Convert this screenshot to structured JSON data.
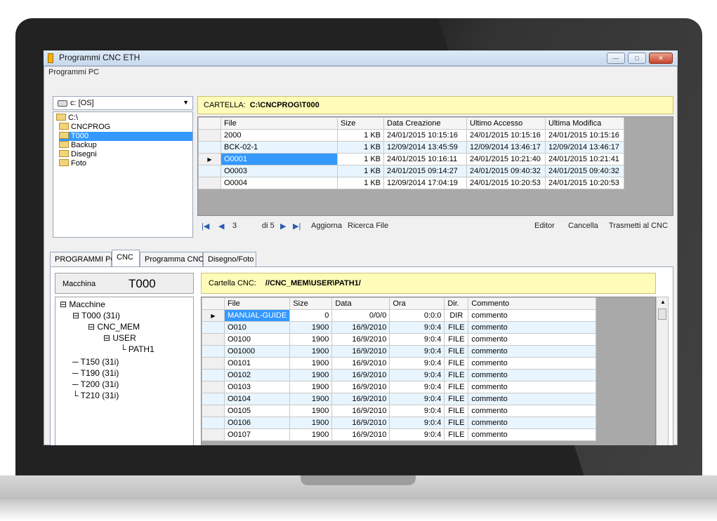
{
  "window": {
    "title": "Programmi CNC ETH",
    "min": "—",
    "max": "□",
    "close": "✕"
  },
  "programmi_pc_label": "Programmi PC",
  "drive_combo": {
    "value": "c: [OS]"
  },
  "folder_tree": [
    "C:\\",
    "CNCPROG",
    "T000",
    "Backup",
    "Disegni",
    "Foto"
  ],
  "cartella": {
    "label": "CARTELLA:",
    "path": "C:\\CNCPROG\\T000"
  },
  "files_table": {
    "headers": [
      "File",
      "Size",
      "Data Creazione",
      "Ultimo Accesso",
      "Ultima Modifica"
    ],
    "rows": [
      [
        "2000",
        "1 KB",
        "24/01/2015 10:15:16",
        "24/01/2015 10:15:16",
        "24/01/2015 10:15:16"
      ],
      [
        "BCK-02-1",
        "1 KB",
        "12/09/2014 13:45:59",
        "12/09/2014 13:46:17",
        "12/09/2014 13:46:17"
      ],
      [
        "O0001",
        "1 KB",
        "24/01/2015 10:16:11",
        "24/01/2015 10:21:40",
        "24/01/2015 10:21:41"
      ],
      [
        "O0003",
        "1 KB",
        "24/01/2015 09:14:27",
        "24/01/2015 09:40:32",
        "24/01/2015 09:40:32"
      ],
      [
        "O0004",
        "1 KB",
        "12/09/2014 17:04:19",
        "24/01/2015 10:20:53",
        "24/01/2015 10:20:53"
      ]
    ]
  },
  "navbar": {
    "position": "3",
    "of": "di 5",
    "aggiorna": "Aggiorna",
    "ricerca": "Ricerca File",
    "editor": "Editor",
    "cancella": "Cancella",
    "trasmetti": "Trasmetti al CNC"
  },
  "tabs": [
    "PROGRAMMI PC",
    "CNC",
    "Programma CNC",
    "Disegno/Foto"
  ],
  "macchina": {
    "label": "Macchina",
    "value": "T000"
  },
  "cartella_cnc": {
    "label": "Cartella CNC:",
    "path": "//CNC_MEM\\USER\\PATH1/"
  },
  "machine_tree": [
    "Macchine",
    "T000 (31i)",
    "CNC_MEM",
    "USER",
    "PATH1",
    "T150 (31i)",
    "T190 (31i)",
    "T200 (31i)",
    "T210 (31i)"
  ],
  "cnc_table": {
    "headers": [
      "File",
      "Size",
      "Data",
      "Ora",
      "Dir.",
      "Commento"
    ],
    "rows": [
      [
        "MANUAL-GUIDE",
        "0",
        "0/0/0",
        "0:0:0",
        "DIR",
        "commento"
      ],
      [
        "O010",
        "1900",
        "16/9/2010",
        "9:0:4",
        "FILE",
        "commento"
      ],
      [
        "O0100",
        "1900",
        "16/9/2010",
        "9:0:4",
        "FILE",
        "commento"
      ],
      [
        "O01000",
        "1900",
        "16/9/2010",
        "9:0:4",
        "FILE",
        "commento"
      ],
      [
        "O0101",
        "1900",
        "16/9/2010",
        "9:0:4",
        "FILE",
        "commento"
      ],
      [
        "O0102",
        "1900",
        "16/9/2010",
        "9:0:4",
        "FILE",
        "commento"
      ],
      [
        "O0103",
        "1900",
        "16/9/2010",
        "9:0:4",
        "FILE",
        "commento"
      ],
      [
        "O0104",
        "1900",
        "16/9/2010",
        "9:0:4",
        "FILE",
        "commento"
      ],
      [
        "O0105",
        "1900",
        "16/9/2010",
        "9:0:4",
        "FILE",
        "commento"
      ],
      [
        "O0106",
        "1900",
        "16/9/2010",
        "9:0:4",
        "FILE",
        "commento"
      ],
      [
        "O0107",
        "1900",
        "16/9/2010",
        "9:0:4",
        "FILE",
        "commento"
      ]
    ]
  }
}
